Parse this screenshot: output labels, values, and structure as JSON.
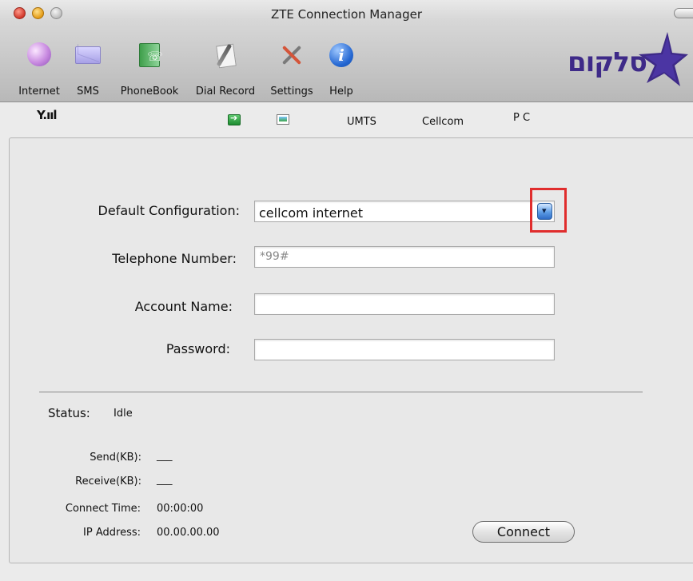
{
  "window": {
    "title": "ZTE Connection Manager"
  },
  "toolbar": {
    "items": [
      {
        "label": "Internet",
        "icon": "globe-icon"
      },
      {
        "label": "SMS",
        "icon": "envelope-icon"
      },
      {
        "label": "PhoneBook",
        "icon": "phonebook-icon"
      },
      {
        "label": "Dial Record",
        "icon": "dial-record-icon"
      },
      {
        "label": "Settings",
        "icon": "settings-tools-icon"
      },
      {
        "label": "Help",
        "icon": "info-icon"
      }
    ]
  },
  "logo": {
    "text": "סלקום",
    "star_color": "#3e2a88"
  },
  "status_strip": {
    "signal": "Y.ııl",
    "network_type": "UMTS",
    "operator": "Cellcom",
    "mode": "P C"
  },
  "form": {
    "default_config_label": "Default Configuration:",
    "default_config_value": "cellcom internet",
    "telephone_label": "Telephone Number:",
    "telephone_value": "*99#",
    "account_label": "Account Name:",
    "account_value": "",
    "password_label": "Password:",
    "password_value": ""
  },
  "status": {
    "status_label": "Status:",
    "status_value": "Idle",
    "send_label": "Send(KB):",
    "send_value": "___",
    "receive_label": "Receive(KB):",
    "receive_value": "___",
    "connect_time_label": "Connect Time:",
    "connect_time_value": "00:00:00",
    "ip_label": "IP Address:",
    "ip_value": "00.00.00.00"
  },
  "actions": {
    "connect_label": "Connect"
  },
  "colors": {
    "highlight": "#e02d2d",
    "accent_blue": "#2f6cc6"
  }
}
